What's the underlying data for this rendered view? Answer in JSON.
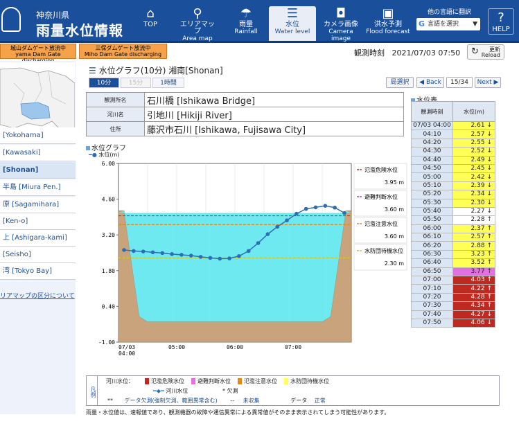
{
  "header": {
    "prefecture": "神奈川県",
    "site_title": "雨量水位情報",
    "nav": [
      {
        "label": "TOP",
        "en": "",
        "icon": "home-icon"
      },
      {
        "label": "エリアマップ",
        "en": "Area map",
        "icon": "map-pin-icon"
      },
      {
        "label": "雨量",
        "en": "Rainfall",
        "icon": "umbrella-icon"
      },
      {
        "label": "水位",
        "en": "Water level",
        "icon": "water-level-icon"
      },
      {
        "label": "カメラ画像",
        "en": "Camera image",
        "icon": "camera-icon"
      },
      {
        "label": "洪水予測",
        "en": "Flood forecast",
        "icon": "flood-forecast-icon"
      }
    ],
    "translate_label": "他の言語に翻訳",
    "translate_select": "言語を選択",
    "help_label": "HELP"
  },
  "gates": [
    {
      "jp": "城山ダムゲート放流中",
      "en": "yama Dam Gate discharging"
    },
    {
      "jp": "三保ダムゲート放流中",
      "en": "Miho Dam Gate discharging"
    }
  ],
  "observation_time_label": "観測時刻",
  "observation_time": "2021/07/03 07:50",
  "reload_label_jp": "更新",
  "reload_label_en": "Reload",
  "sidebar": {
    "items": [
      "[Yokohama]",
      "[Kawasaki]",
      "[Shonan]",
      "半島 [Miura Pen.]",
      "原 [Sagamihara]",
      "[Ken-o]",
      "上 [Ashigara-kami]",
      "[Seisho]",
      "湾 [Tokyo Bay]"
    ],
    "active_index": 2,
    "area_link": "リアマップの区分について"
  },
  "page_title": "水位グラフ(10分) 湘南[Shonan]",
  "intervals": [
    "10分",
    "15分",
    "1時間"
  ],
  "pager": {
    "select": "局選択",
    "back": "◀ Back",
    "page": "15/34",
    "next": "Next ▶"
  },
  "info": {
    "station_label": "観測所名",
    "station": "石川橋 [Ishikawa Bridge]",
    "river_label": "河川名",
    "river": "引地川 [Hikiji River]",
    "address_label": "住所",
    "address": "藤沢市石川 [Ishikawa, Fujisawa City]"
  },
  "graph_section": "水位グラフ",
  "graph_series_label": "水位(m)",
  "chart_data": {
    "type": "line",
    "title": "水位グラフ",
    "ylabel": "水位(m)",
    "ylim": [
      -1.0,
      6.0
    ],
    "yticks": [
      "6.00",
      "4.60",
      "3.20",
      "1.80",
      "0.40",
      "-1.00"
    ],
    "xticks": [
      "07/03\n04:00",
      "05:00",
      "06:00",
      "07:00"
    ],
    "x": [
      "04:00",
      "04:10",
      "04:20",
      "04:30",
      "04:40",
      "04:50",
      "05:00",
      "05:10",
      "05:20",
      "05:30",
      "05:40",
      "05:50",
      "06:00",
      "06:10",
      "06:20",
      "06:30",
      "06:40",
      "06:50",
      "07:00",
      "07:10",
      "07:20",
      "07:30",
      "07:40",
      "07:50"
    ],
    "series": [
      {
        "name": "河川水位",
        "values": [
          2.61,
          2.57,
          2.55,
          2.52,
          2.49,
          2.45,
          2.42,
          2.39,
          2.34,
          2.3,
          2.27,
          2.28,
          2.37,
          2.57,
          2.88,
          3.23,
          3.52,
          3.77,
          4.03,
          4.22,
          4.28,
          4.34,
          4.27,
          4.06
        ]
      }
    ],
    "thresholds": [
      {
        "name": "氾濫危険水位",
        "value": 3.95,
        "label": "3.95 m",
        "color": "#c0392b"
      },
      {
        "name": "避難判断水位",
        "value": 3.6,
        "label": "3.60 m",
        "color": "#b03ad6"
      },
      {
        "name": "氾濫注意水位",
        "value": 3.6,
        "label": "3.60 m",
        "color": "#e08a1e"
      },
      {
        "name": "水防団待機水位",
        "value": 2.3,
        "label": "2.30 m",
        "color": "#d9c61a"
      }
    ]
  },
  "table_section": "水位表",
  "table_headers": [
    "観測時刻",
    "水位(m)"
  ],
  "table_rows": [
    {
      "time": "07/03 04:00",
      "value": "2.61 ↓",
      "color": "#ffff55"
    },
    {
      "time": "04:10",
      "value": "2.57 ↓",
      "color": "#ffff55"
    },
    {
      "time": "04:20",
      "value": "2.55 ↓",
      "color": "#ffff55"
    },
    {
      "time": "04:30",
      "value": "2.52 ↓",
      "color": "#ffff55"
    },
    {
      "time": "04:40",
      "value": "2.49 ↓",
      "color": "#ffff55"
    },
    {
      "time": "04:50",
      "value": "2.45 ↓",
      "color": "#ffff55"
    },
    {
      "time": "05:00",
      "value": "2.42 ↓",
      "color": "#ffff55"
    },
    {
      "time": "05:10",
      "value": "2.39 ↓",
      "color": "#ffff55"
    },
    {
      "time": "05:20",
      "value": "2.34 ↓",
      "color": "#ffff55"
    },
    {
      "time": "05:30",
      "value": "2.30 ↓",
      "color": "#ffff55"
    },
    {
      "time": "05:40",
      "value": "2.27 ↓",
      "color": "#ffffff"
    },
    {
      "time": "05:50",
      "value": "2.28 ↑",
      "color": "#ffffff"
    },
    {
      "time": "06:00",
      "value": "2.37 ↑",
      "color": "#ffff55"
    },
    {
      "time": "06:10",
      "value": "2.57 ↑",
      "color": "#ffff55"
    },
    {
      "time": "06:20",
      "value": "2.88 ↑",
      "color": "#ffff55"
    },
    {
      "time": "06:30",
      "value": "3.23 ↑",
      "color": "#ffff55"
    },
    {
      "time": "06:40",
      "value": "3.52 ↑",
      "color": "#ffff55"
    },
    {
      "time": "06:50",
      "value": "3.77 ↑",
      "color": "#e46fe0"
    },
    {
      "time": "07:00",
      "value": "4.03 ↑",
      "color": "#c0291f"
    },
    {
      "time": "07:10",
      "value": "4.22 ↑",
      "color": "#c0291f"
    },
    {
      "time": "07:20",
      "value": "4.28 ↑",
      "color": "#c0291f"
    },
    {
      "time": "07:30",
      "value": "4.34 ↑",
      "color": "#c0291f"
    },
    {
      "time": "07:40",
      "value": "4.27 ↓",
      "color": "#c0291f"
    },
    {
      "time": "07:50",
      "value": "4.06 ↓",
      "color": "#c0291f"
    }
  ],
  "legend": {
    "side": "凡例",
    "river_level_label": "河川水位：",
    "items": [
      {
        "label": "氾濫危険水位",
        "color": "#c0291f"
      },
      {
        "label": "避難判断水位",
        "color": "#e46fe0"
      },
      {
        "label": "氾濫注意水位",
        "color": "#e08a1e"
      },
      {
        "label": "水防団待機水位",
        "color": "#ffff55"
      }
    ],
    "line_label": "河川水位",
    "missing_label": "* 欠測",
    "missing2_mark": "**",
    "missing2_label": "データ欠測(強制欠測、範囲異常含む)",
    "uncollected_mark": "--",
    "uncollected_label": "未収集",
    "normal_mark": "データ",
    "normal_label": "正常"
  },
  "footnote": "雨量・水位値は、速報値であり、観測機器の故障や通信異常による異常値がそのまま表示されてしまう可能性があります。"
}
